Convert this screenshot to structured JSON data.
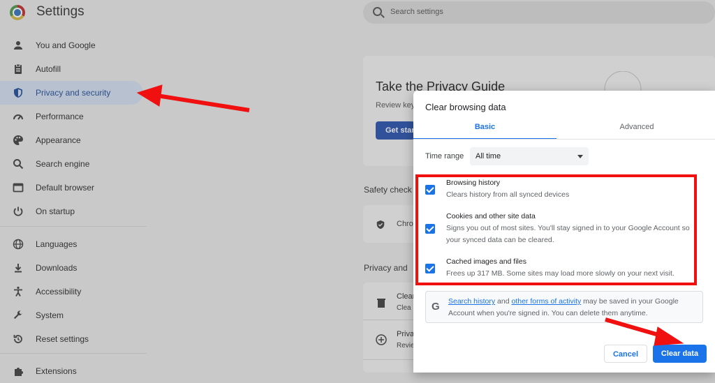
{
  "app": {
    "title": "Settings"
  },
  "search": {
    "placeholder": "Search settings"
  },
  "sidebar": {
    "items": [
      {
        "label": "You and Google",
        "icon": "person-icon"
      },
      {
        "label": "Autofill",
        "icon": "clipboard-icon"
      },
      {
        "label": "Privacy and security",
        "icon": "shield-icon",
        "active": true
      },
      {
        "label": "Performance",
        "icon": "gauge-icon"
      },
      {
        "label": "Appearance",
        "icon": "palette-icon"
      },
      {
        "label": "Search engine",
        "icon": "search-icon"
      },
      {
        "label": "Default browser",
        "icon": "browser-icon"
      },
      {
        "label": "On startup",
        "icon": "power-icon"
      },
      {
        "label": "Languages",
        "icon": "globe-icon"
      },
      {
        "label": "Downloads",
        "icon": "download-icon"
      },
      {
        "label": "Accessibility",
        "icon": "accessibility-icon"
      },
      {
        "label": "System",
        "icon": "wrench-icon"
      },
      {
        "label": "Reset settings",
        "icon": "reset-icon"
      },
      {
        "label": "Extensions",
        "icon": "puzzle-icon"
      }
    ]
  },
  "main": {
    "guide_title": "Take the Privacy Guide",
    "guide_sub": "Review key",
    "get_started": "Get star",
    "safety_check": "Safety check",
    "safety_item": "Chro",
    "privacy_header": "Privacy and",
    "row1_title": "Clear",
    "row1_sub": "Clea",
    "row2_title": "Priva",
    "row2_sub": "Revie"
  },
  "dialog": {
    "title": "Clear browsing data",
    "tabs": {
      "basic": "Basic",
      "advanced": "Advanced"
    },
    "time_range_label": "Time range",
    "time_range_value": "All time",
    "options": [
      {
        "title": "Browsing history",
        "desc": "Clears history from all synced devices",
        "checked": true
      },
      {
        "title": "Cookies and other site data",
        "desc1": "Signs you out of most sites. You'll stay signed in to your Google Account so",
        "desc2": "your synced data can be cleared.",
        "checked": true
      },
      {
        "title": "Cached images and files",
        "desc": "Frees up 317 MB. Some sites may load more slowly on your next visit.",
        "checked": true
      }
    ],
    "info": {
      "link1": "Search history",
      "and": " and ",
      "link2": "other forms of activity",
      "rest": " may be saved in your Google Account when you're signed in. You can delete them anytime."
    },
    "cancel_label": "Cancel",
    "clear_label": "Clear data"
  },
  "colors": {
    "accent": "#1a73e8",
    "annotation": "#f01010"
  }
}
